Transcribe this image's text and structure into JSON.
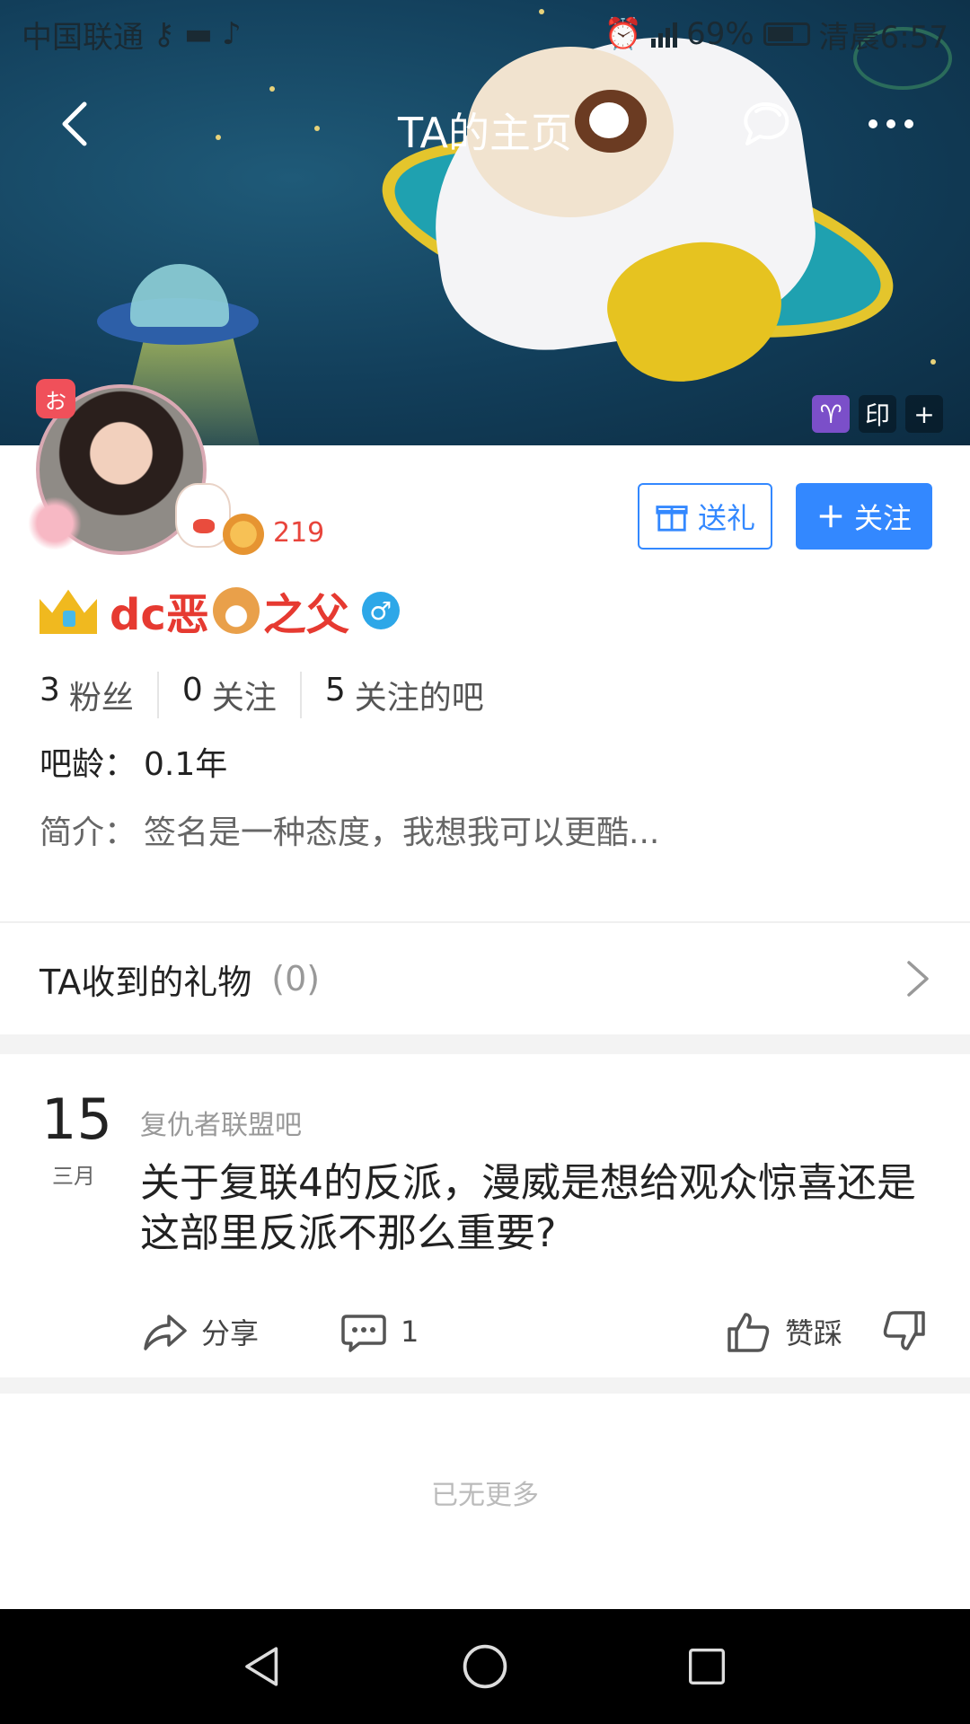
{
  "status_bar": {
    "carrier": "中国联通",
    "battery": "69%",
    "time": "清晨6:57"
  },
  "nav": {
    "title": "TA的主页"
  },
  "banner_tags": {
    "zodiac": "♈",
    "seal": "印",
    "add": "+"
  },
  "profile": {
    "pendant_badge": "お",
    "level": "219",
    "username_part1": "dc恶",
    "username_part2": "之父",
    "gender": "♂",
    "gift_button": "送礼",
    "follow_button": "关注",
    "stats": [
      {
        "num": "3",
        "label": "粉丝"
      },
      {
        "num": "0",
        "label": "关注"
      },
      {
        "num": "5",
        "label": "关注的吧"
      }
    ],
    "age_label": "吧龄：",
    "age_value": "0.1年",
    "bio_label": "简介：",
    "bio_value": "签名是一种态度，我想我可以更酷..."
  },
  "gifts": {
    "title": "TA收到的礼物",
    "count": "(0)"
  },
  "post": {
    "day": "15",
    "month": "三月",
    "forum": "复仇者联盟吧",
    "title": "关于复联4的反派，漫威是想给观众惊喜还是这部里反派不那么重要?",
    "share_label": "分享",
    "comment_count": "1",
    "vote_label": "赞踩"
  },
  "footer": {
    "no_more": "已无更多"
  },
  "colors": {
    "accent": "#3388ff",
    "username": "#e63a31",
    "level": "#e8453c"
  }
}
